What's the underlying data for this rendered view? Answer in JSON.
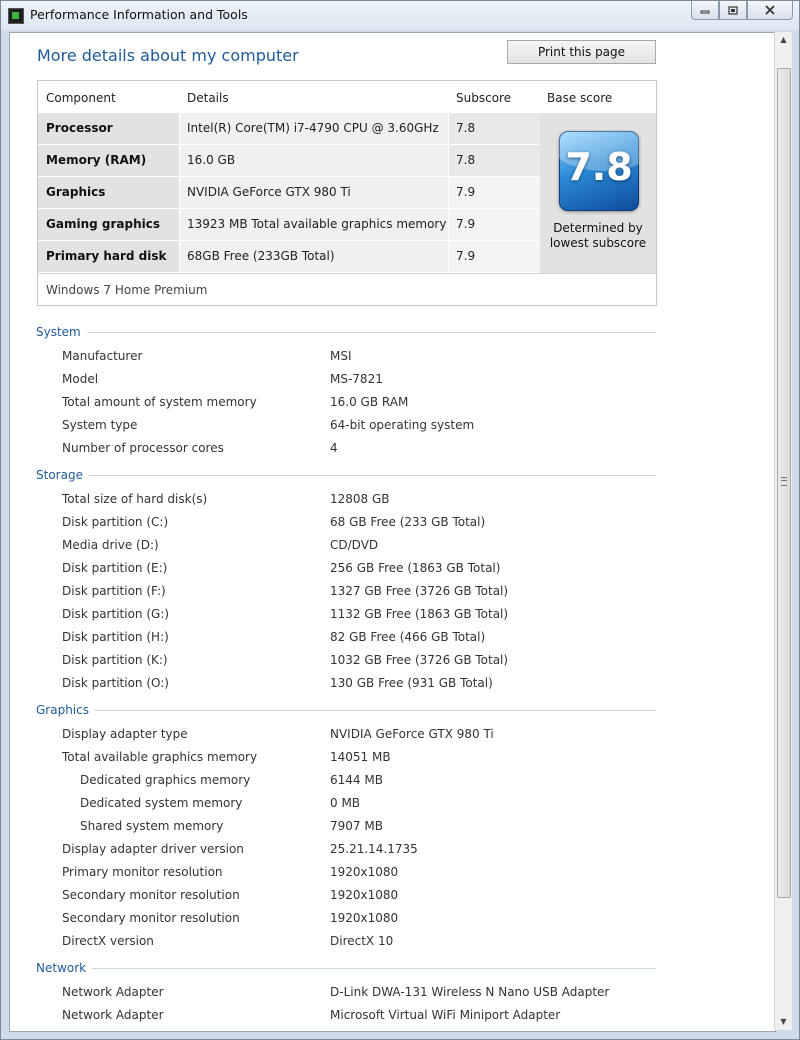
{
  "window": {
    "title": "Performance Information and Tools",
    "minimize_icon": "minimize-icon",
    "maximize_icon": "maximize-icon",
    "close_icon": "close-icon"
  },
  "page": {
    "heading": "More details about my computer",
    "print_label": "Print this page"
  },
  "score_table": {
    "headers": [
      "Component",
      "Details",
      "Subscore",
      "Base score"
    ],
    "rows": [
      {
        "component": "Processor",
        "details": "Intel(R) Core(TM) i7-4790 CPU @ 3.60GHz",
        "subscore": "7.8"
      },
      {
        "component": "Memory (RAM)",
        "details": "16.0 GB",
        "subscore": "7.8"
      },
      {
        "component": "Graphics",
        "details": "NVIDIA GeForce GTX 980 Ti",
        "subscore": "7.9"
      },
      {
        "component": "Gaming graphics",
        "details": "13923 MB Total available graphics memory",
        "subscore": "7.9"
      },
      {
        "component": "Primary hard disk",
        "details": "68GB Free (233GB Total)",
        "subscore": "7.9"
      }
    ],
    "base_score": "7.8",
    "base_caption_line1": "Determined by",
    "base_caption_line2": "lowest subscore",
    "edition": "Windows 7 Home Premium"
  },
  "sections": {
    "system": {
      "title": "System",
      "items": [
        {
          "label": "Manufacturer",
          "value": "MSI"
        },
        {
          "label": "Model",
          "value": "MS-7821"
        },
        {
          "label": "Total amount of system memory",
          "value": "16.0 GB RAM"
        },
        {
          "label": "System type",
          "value": "64-bit operating system"
        },
        {
          "label": "Number of processor cores",
          "value": "4"
        }
      ]
    },
    "storage": {
      "title": "Storage",
      "items": [
        {
          "label": "Total size of hard disk(s)",
          "value": "12808 GB"
        },
        {
          "label": "Disk partition (C:)",
          "value": "68 GB Free (233 GB Total)"
        },
        {
          "label": "Media drive (D:)",
          "value": "CD/DVD"
        },
        {
          "label": "Disk partition (E:)",
          "value": "256 GB Free (1863 GB Total)"
        },
        {
          "label": "Disk partition (F:)",
          "value": "1327 GB Free (3726 GB Total)"
        },
        {
          "label": "Disk partition (G:)",
          "value": "1132 GB Free (1863 GB Total)"
        },
        {
          "label": "Disk partition (H:)",
          "value": "82 GB Free (466 GB Total)"
        },
        {
          "label": "Disk partition (K:)",
          "value": "1032 GB Free (3726 GB Total)"
        },
        {
          "label": "Disk partition (O:)",
          "value": "130 GB Free (931 GB Total)"
        }
      ]
    },
    "graphics": {
      "title": "Graphics",
      "items": [
        {
          "label": "Display adapter type",
          "value": "NVIDIA GeForce GTX 980 Ti"
        },
        {
          "label": "Total available graphics memory",
          "value": "14051 MB"
        },
        {
          "label": "Dedicated graphics memory",
          "value": "6144 MB"
        },
        {
          "label": "Dedicated system memory",
          "value": "0 MB"
        },
        {
          "label": "Shared system memory",
          "value": "7907 MB"
        },
        {
          "label": "Display adapter driver version",
          "value": "25.21.14.1735"
        },
        {
          "label": "Primary monitor resolution",
          "value": "1920x1080"
        },
        {
          "label": "Secondary monitor resolution",
          "value": "1920x1080"
        },
        {
          "label": "Secondary monitor resolution",
          "value": "1920x1080"
        },
        {
          "label": "DirectX version",
          "value": "DirectX 10"
        }
      ]
    },
    "network": {
      "title": "Network",
      "items": [
        {
          "label": "Network Adapter",
          "value": "D-Link DWA-131 Wireless N Nano USB Adapter"
        },
        {
          "label": "Network Adapter",
          "value": "Microsoft Virtual WiFi Miniport Adapter"
        }
      ]
    }
  }
}
